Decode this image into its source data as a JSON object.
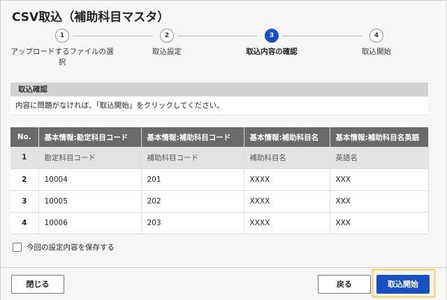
{
  "dialog": {
    "title": "CSV取込（補助科目マスタ）"
  },
  "stepper": {
    "steps": [
      {
        "number": "1",
        "label": "アップロードするファイルの選択"
      },
      {
        "number": "2",
        "label": "取込設定"
      },
      {
        "number": "3",
        "label": "取込内容の確認"
      },
      {
        "number": "4",
        "label": "取込開始"
      }
    ],
    "current_step": 3
  },
  "confirm": {
    "heading": "取込確認",
    "message": "内容に問題がなければ、「取込開始」をクリックしてください。"
  },
  "table": {
    "headers": [
      "No.",
      "基本情報:勘定科目コード",
      "基本情報:補助科目コード",
      "基本情報:補助科目名",
      "基本情報:補助科目名英語"
    ],
    "rows": [
      [
        "1",
        "勘定科目コード",
        "補助科目コード",
        "補助科目名",
        "英語名"
      ],
      [
        "2",
        "10004",
        "201",
        "XXXX",
        "XXX"
      ],
      [
        "3",
        "10005",
        "202",
        "XXXX",
        "XXX"
      ],
      [
        "4",
        "10006",
        "203",
        "XXXX",
        "XXX"
      ]
    ]
  },
  "save_option": {
    "label": "今回の設定内容を保存する",
    "checked": false
  },
  "footer": {
    "close_label": "閉じる",
    "back_label": "戻る",
    "start_label": "取込開始"
  },
  "colors": {
    "primary": "#1a4fc2",
    "table_header": "#6a6a6a",
    "highlight": "#f2dc8a"
  }
}
